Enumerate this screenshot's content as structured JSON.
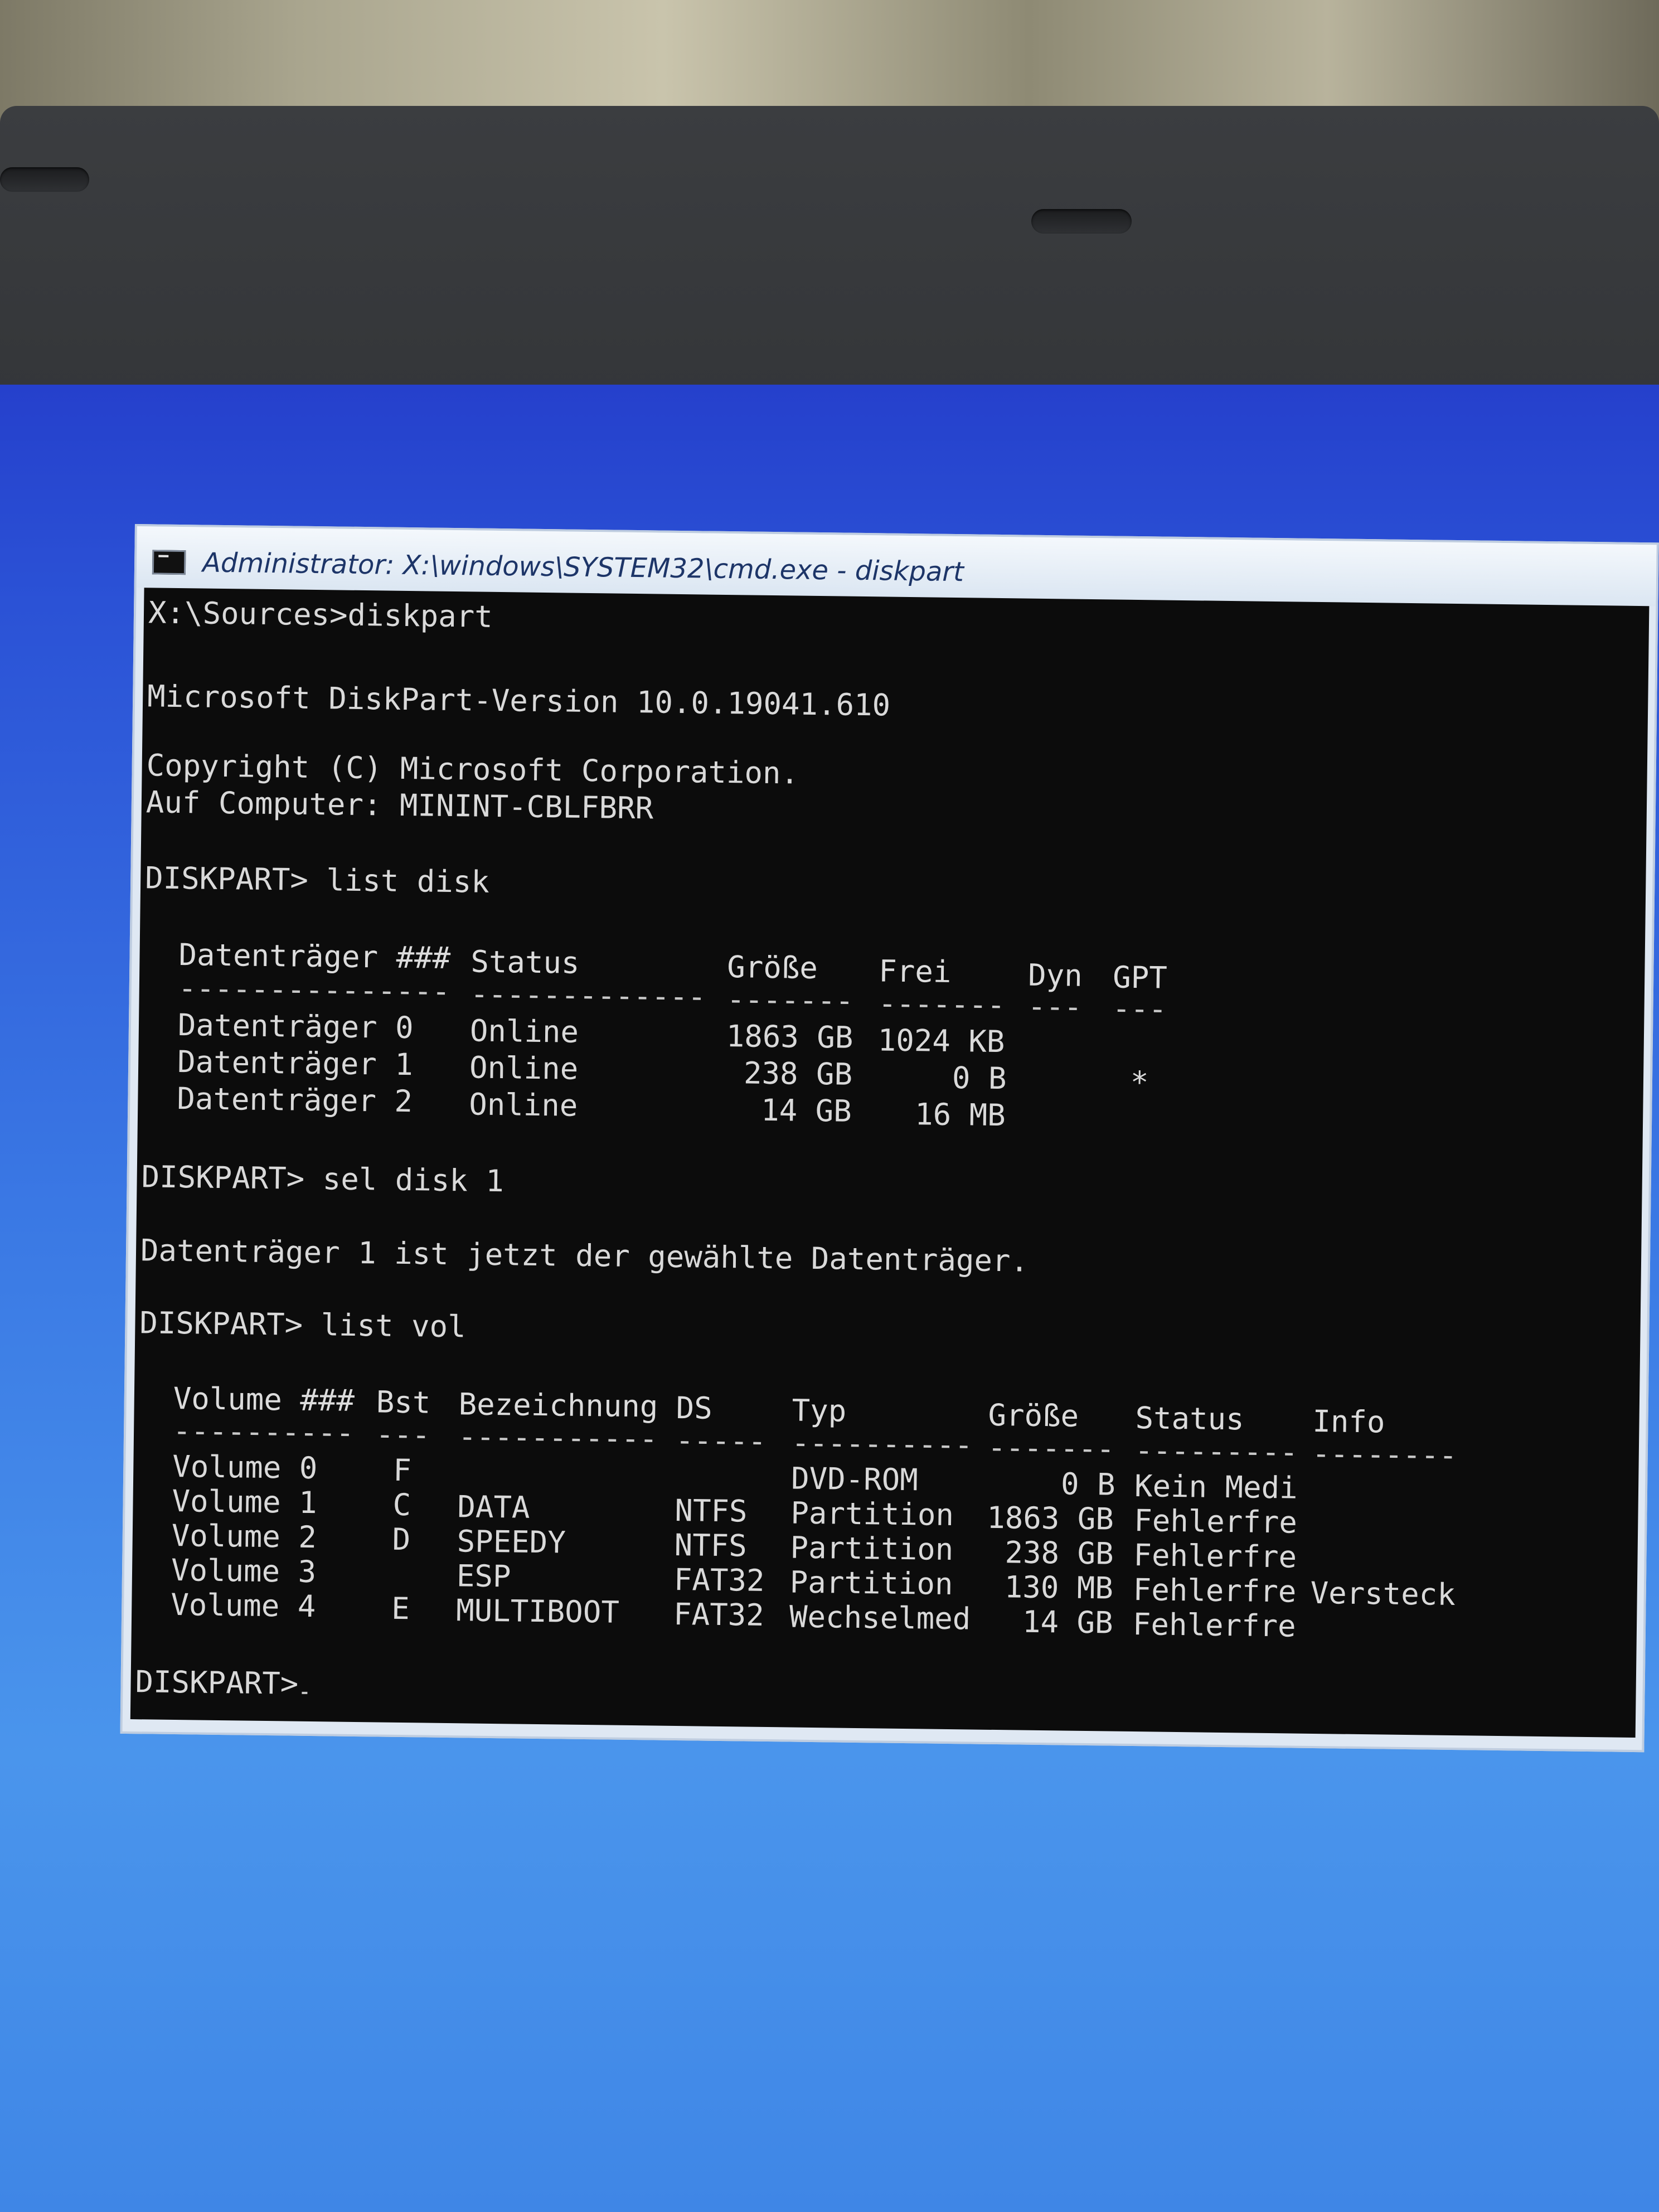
{
  "window": {
    "title": "Administrator: X:\\windows\\SYSTEM32\\cmd.exe - diskpart"
  },
  "console": {
    "line_cmd1": "X:\\Sources>diskpart",
    "line_version": "Microsoft DiskPart-Version 10.0.19041.610",
    "line_copyright": "Copyright (C) Microsoft Corporation.",
    "line_computer": "Auf Computer: MININT-CBLFBRR",
    "line_cmd2": "DISKPART> list disk",
    "line_cmd3": "DISKPART> sel disk 1",
    "line_selected": "Datenträger 1 ist jetzt der gewählte Datenträger.",
    "line_cmd4": "DISKPART> list vol",
    "prompt": "DISKPART>"
  },
  "disk_table": {
    "headers": {
      "disk": "Datenträger ###",
      "status": "Status",
      "size": "Größe",
      "free": "Frei",
      "dyn": "Dyn",
      "gpt": "GPT"
    },
    "dashes": {
      "disk": "---------------",
      "status": "-------------",
      "size": "-------",
      "free": "-------",
      "dyn": "---",
      "gpt": "---"
    },
    "rows": [
      {
        "disk": "Datenträger 0",
        "status": "Online",
        "size": "1863 GB",
        "free": "1024 KB",
        "dyn": "",
        "gpt": ""
      },
      {
        "disk": "Datenträger 1",
        "status": "Online",
        "size": "238 GB",
        "free": "0 B",
        "dyn": "",
        "gpt": "*"
      },
      {
        "disk": "Datenträger 2",
        "status": "Online",
        "size": "14 GB",
        "free": "16 MB",
        "dyn": "",
        "gpt": ""
      }
    ]
  },
  "volume_table": {
    "headers": {
      "volume": "Volume ###",
      "bst": "Bst",
      "label": "Bezeichnung",
      "ds": "DS",
      "type": "Typ",
      "size": "Größe",
      "status": "Status",
      "info": "Info"
    },
    "dashes": {
      "volume": "----------",
      "bst": "---",
      "label": "-----------",
      "ds": "-----",
      "type": "----------",
      "size": "-------",
      "status": "---------",
      "info": "--------"
    },
    "rows": [
      {
        "volume": "Volume 0",
        "bst": "F",
        "label": "",
        "ds": "",
        "type": "DVD-ROM",
        "size": "0 B",
        "status": "Kein Medi",
        "info": ""
      },
      {
        "volume": "Volume 1",
        "bst": "C",
        "label": "DATA",
        "ds": "NTFS",
        "type": "Partition",
        "size": "1863 GB",
        "status": "Fehlerfre",
        "info": ""
      },
      {
        "volume": "Volume 2",
        "bst": "D",
        "label": "SPEEDY",
        "ds": "NTFS",
        "type": "Partition",
        "size": "238 GB",
        "status": "Fehlerfre",
        "info": ""
      },
      {
        "volume": "Volume 3",
        "bst": "",
        "label": "ESP",
        "ds": "FAT32",
        "type": "Partition",
        "size": "130 MB",
        "status": "Fehlerfre",
        "info": "Versteck"
      },
      {
        "volume": "Volume 4",
        "bst": "E",
        "label": "MULTIBOOT",
        "ds": "FAT32",
        "type": "Wechselmed",
        "size": "14 GB",
        "status": "Fehlerfre",
        "info": ""
      }
    ]
  }
}
